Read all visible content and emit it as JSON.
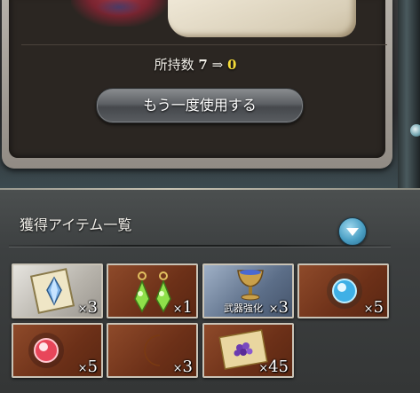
{
  "dialog": {
    "count_label": "所持数",
    "count_current": "7",
    "count_arrow": "⇒",
    "count_new": "0",
    "use_again_label": "もう一度使用する"
  },
  "items_section": {
    "title": "獲得アイテム一覧",
    "items": [
      {
        "icon": "crystal-card-icon",
        "qty_prefix": "×",
        "qty": "3"
      },
      {
        "icon": "green-earrings-icon",
        "qty_prefix": "×",
        "qty": "1"
      },
      {
        "icon": "weapon-enhance-chalice-icon",
        "label": "武器強化",
        "qty_prefix": "×",
        "qty": "3"
      },
      {
        "icon": "blue-orb-icon",
        "qty_prefix": "×",
        "qty": "5"
      },
      {
        "icon": "red-orb-icon",
        "qty_prefix": "×",
        "qty": "5"
      },
      {
        "icon": "crescent-moon-icon",
        "qty_prefix": "×",
        "qty": "3"
      },
      {
        "icon": "purple-gems-scroll-icon",
        "qty_prefix": "×",
        "qty": "45"
      }
    ]
  },
  "colors": {
    "new_count": "#f5dc3a",
    "expand_button": "#4a9fc4",
    "slot_border": "#c9c3b6"
  }
}
